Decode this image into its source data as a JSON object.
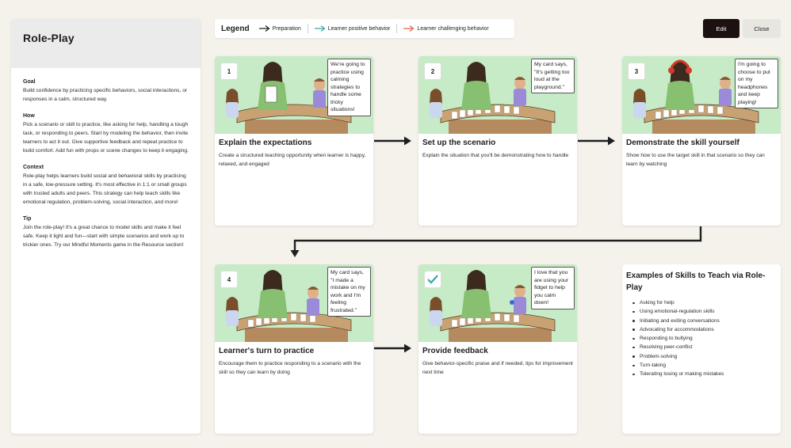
{
  "sidebar": {
    "title": "Role-Play",
    "sections": [
      {
        "title": "Goal",
        "text": "Build confidence by practicing specific behaviors, social interactions, or responses in a calm, structured way."
      },
      {
        "title": "How",
        "text": "Pick a scenario or skill to practice, like asking for help, handling a tough task, or responding to peers. Start by modeling the behavior, then invite learners to act it out. Give supportive feedback and repeat practice to build comfort. Add fun with props or scene changes to keep it engaging."
      },
      {
        "title": "Context",
        "text": "Role-play helps learners build social and behavioral skills by practicing in a safe, low-pressure setting. It's most effective in 1:1 or small groups with trusted adults and peers. This strategy can help teach skills like emotional regulation, problem-solving, social interaction, and more!"
      },
      {
        "title": "Tip",
        "text": "Join the role-play! It's a great chance to model skills and make it feel safe. Keep it light and fun—start with simple scenarios and work up to trickier ones. Try our Mindful Moments game in the Resource section!"
      }
    ]
  },
  "legend": {
    "title": "Legend",
    "items": [
      {
        "label": "Preparation",
        "color": "#1f1f1f"
      },
      {
        "label": "Learner positive behavior",
        "color": "#3aa6a6"
      },
      {
        "label": "Learner challenging behavior",
        "color": "#e0684a"
      }
    ]
  },
  "buttons": {
    "edit": "Edit",
    "close": "Close"
  },
  "cards": [
    {
      "num": "1",
      "title": "Explain the expectations",
      "desc": "Create a structured teaching opportunity when learner is happy, relaxed, and engaged",
      "bubble": "We're going to practice using calming strategies to handle some tricky situations!"
    },
    {
      "num": "2",
      "title": "Set up the scenario",
      "desc": "Explain the situation that you'll be demonstrating how to handle",
      "bubble": "My card says, \"It's getting too loud at the playground.\""
    },
    {
      "num": "3",
      "title": "Demonstrate the skill yourself",
      "desc": "Show how to use the target skill in that scenario so they can learn by watching",
      "bubble": "I'm going to choose to put on my headphones and keep playing!"
    },
    {
      "num": "4",
      "title": "Learner's turn to practice",
      "desc": "Encourage them to practice responding to a scenario with the skill so they can learn by doing",
      "bubble": "My card says, \"I made a mistake on my work and I'm feeling frustrated.\""
    },
    {
      "num": "",
      "title": "Provide feedback",
      "desc": "Give behavior-specific praise and if needed, tips for improvement next time",
      "bubble": "I love that you are using your fidget to help you calm down!"
    }
  ],
  "examples": {
    "title": "Examples of Skills to Teach via Role-Play",
    "items": [
      "Asking for help",
      "Using emotional-regulation skills",
      "Initiating and exiting conversations",
      "Advocating for accommodations",
      "Responding to bullying",
      "Resolving peer-conflict",
      "Problem-solving",
      "Turn-taking",
      "Tolerating losing or making mistakes"
    ]
  },
  "colors": {
    "illustration_bg": "#c6ebc6",
    "edit_button": "#1c1010",
    "check": "#3aa6a6"
  }
}
